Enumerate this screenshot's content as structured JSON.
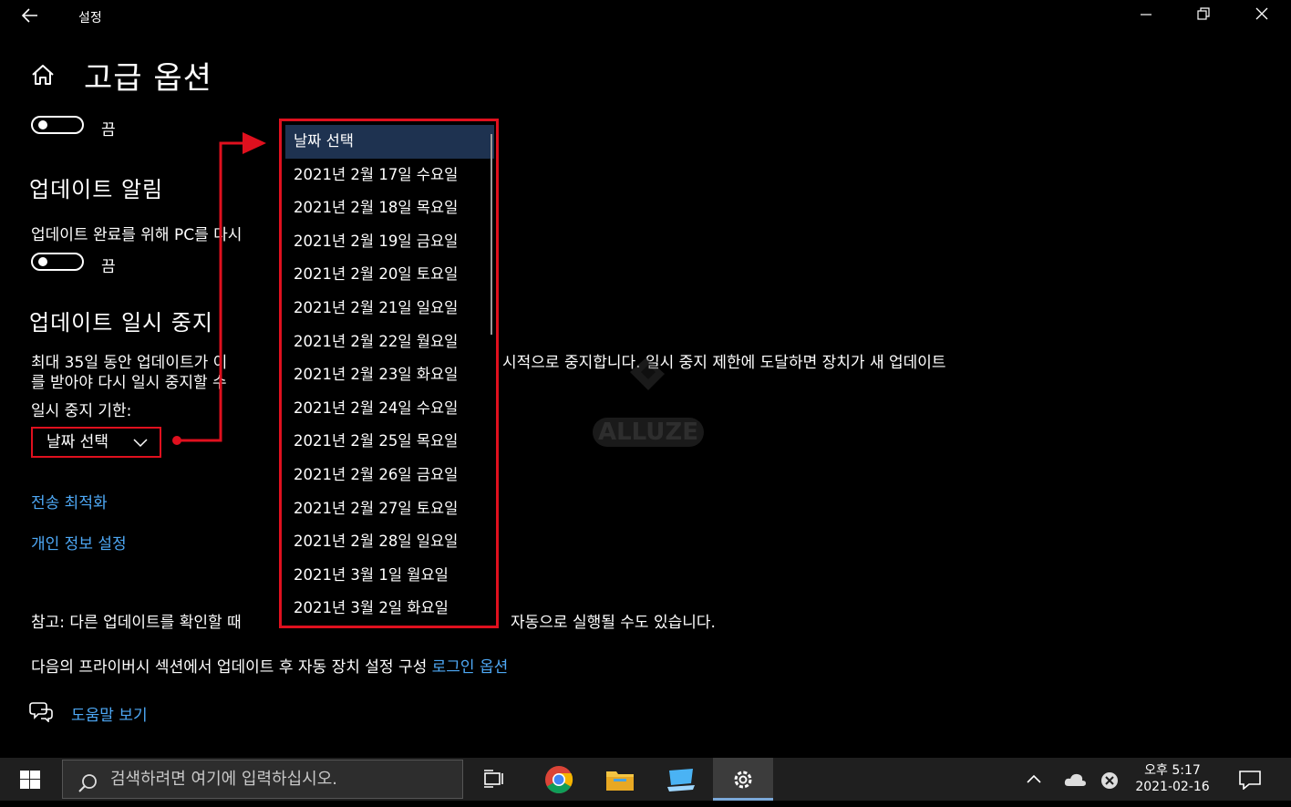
{
  "window": {
    "title": "설정"
  },
  "page": {
    "title": "고급 옵션"
  },
  "settings": {
    "toggle1_state": "끔",
    "notify_heading": "업데이트 알림",
    "notify_desc": "업데이트 완료를 위해 PC를 다시",
    "toggle2_state": "끔",
    "pause_heading": "업데이트 일시 중지",
    "pause_desc_line1_a": "최대 35일 동안 업데이트가 이 ",
    "pause_desc_line1_b": "시적으로 중지합니다. 일시 중지 제한에 도달하면 장치가 새 업데이트",
    "pause_desc_line2": "를 받아야 다시 일시 중지할 수 ",
    "pause_until_label": "일시 중지 기한:",
    "dropdown_value": "날짜 선택",
    "link_delivery": "전송 최적화",
    "link_privacy": "개인 정보 설정",
    "note_a": "참고: 다른 업데이트를 확인할 때",
    "note_b": "자동으로 실행될 수도 있습니다.",
    "privacy_line": "다음의 프라이버시 섹션에서 업데이트 후 자동 장치 설정 구성 ",
    "privacy_link": "로그인 옵션",
    "help_link": "도움말 보기"
  },
  "date_popup": {
    "items": [
      "날짜 선택",
      "2021년 2월 17일 수요일",
      "2021년 2월 18일 목요일",
      "2021년 2월 19일 금요일",
      "2021년 2월 20일 토요일",
      "2021년 2월 21일 일요일",
      "2021년 2월 22일 월요일",
      "2021년 2월 23일 화요일",
      "2021년 2월 24일 수요일",
      "2021년 2월 25일 목요일",
      "2021년 2월 26일 금요일",
      "2021년 2월 27일 토요일",
      "2021년 2월 28일 일요일",
      "2021년 3월 1일 월요일",
      "2021년 3월 2일 화요일"
    ],
    "selected_index": 0
  },
  "watermark": {
    "text": "ALLUZE"
  },
  "taskbar": {
    "search_placeholder": "검색하려면 여기에 입력하십시오.",
    "time": "오후 5:17",
    "date": "2021-02-16"
  },
  "colors": {
    "accent_link": "#4ea8f5",
    "highlight_red": "#e0101e",
    "selected_item": "#1e3250"
  }
}
